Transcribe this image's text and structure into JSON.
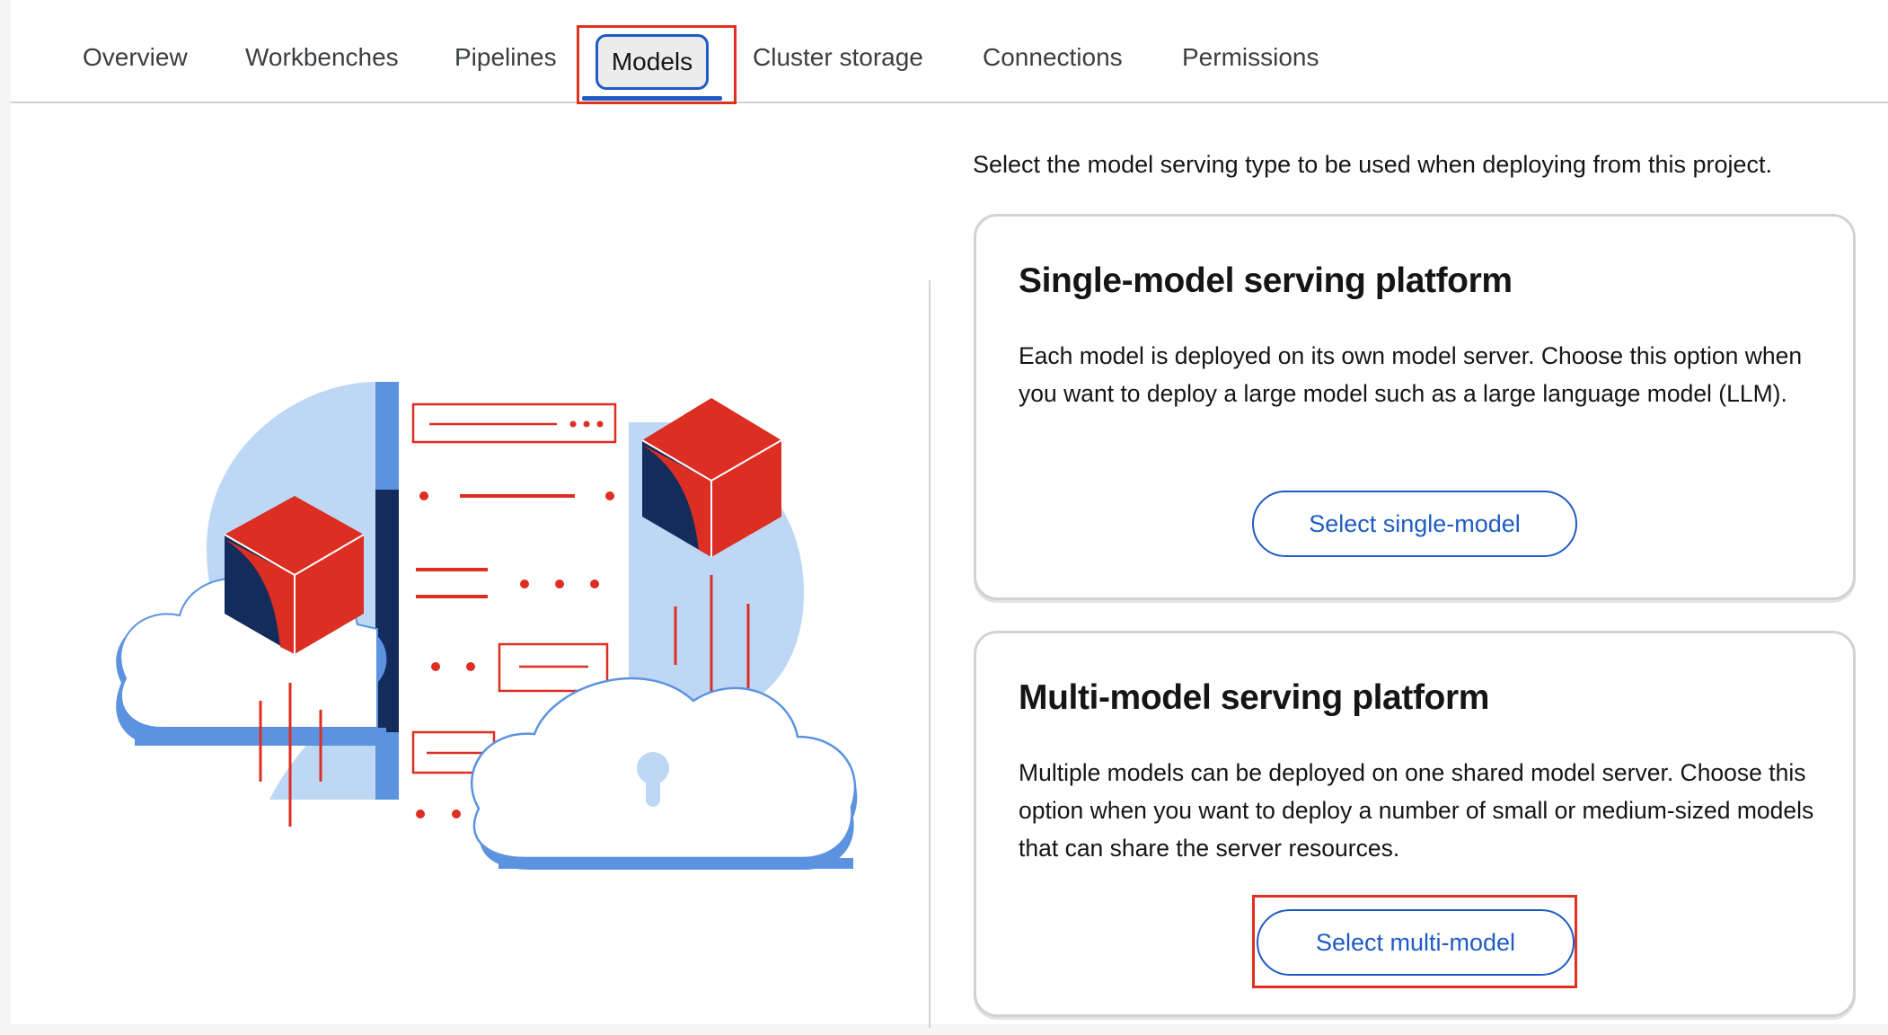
{
  "tabs": [
    {
      "label": "Overview"
    },
    {
      "label": "Workbenches"
    },
    {
      "label": "Pipelines"
    },
    {
      "label": "Models",
      "active": true
    },
    {
      "label": "Cluster storage"
    },
    {
      "label": "Connections"
    },
    {
      "label": "Permissions"
    }
  ],
  "intro_text": "Select the model serving type to be used when deploying from this project.",
  "cards": [
    {
      "title": "Single-model serving platform",
      "body": "Each model is deployed on its own model server. Choose this option when you want to deploy a large model such as a large language model (LLM).",
      "button_label": "Select single-model"
    },
    {
      "title": "Multi-model serving platform",
      "body": "Multiple models can be deployed on one shared model server. Choose this option when you want to deploy a number of small or medium-sized models that can share the server resources.",
      "button_label": "Select multi-model"
    }
  ],
  "colors": {
    "accent": "#1f5bc6",
    "highlight": "#e0301e",
    "cube_red": "#dc2e22",
    "navy": "#132c5c",
    "light_blue": "#bdd7f5",
    "mid_blue": "#5b93e0"
  }
}
